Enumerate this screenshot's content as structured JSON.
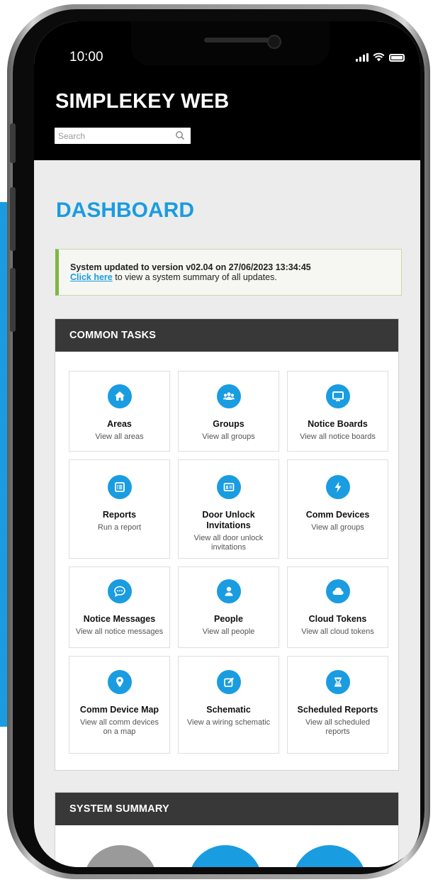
{
  "status": {
    "time": "10:00"
  },
  "header": {
    "app_title": "SIMPLEKEY WEB",
    "search_placeholder": "Search"
  },
  "page": {
    "title": "DASHBOARD"
  },
  "notice": {
    "message": "System updated to version v02.04 on 27/06/2023 13:34:45",
    "link_text": "Click here",
    "link_suffix": " to view a system summary of all updates."
  },
  "common_tasks": {
    "heading": "COMMON TASKS",
    "tiles": [
      {
        "title": "Areas",
        "desc": "View all areas",
        "icon": "home-icon"
      },
      {
        "title": "Groups",
        "desc": "View all groups",
        "icon": "users-icon"
      },
      {
        "title": "Notice Boards",
        "desc": "View all notice boards",
        "icon": "monitor-icon"
      },
      {
        "title": "Reports",
        "desc": "Run a report",
        "icon": "list-icon"
      },
      {
        "title": "Door Unlock Invitations",
        "desc": "View all door unlock invitations",
        "icon": "id-card-icon"
      },
      {
        "title": "Comm Devices",
        "desc": "View all groups",
        "icon": "bolt-icon"
      },
      {
        "title": "Notice Messages",
        "desc": "View all notice messages",
        "icon": "chat-icon"
      },
      {
        "title": "People",
        "desc": "View all people",
        "icon": "person-icon"
      },
      {
        "title": "Cloud Tokens",
        "desc": "View all cloud tokens",
        "icon": "cloud-icon"
      },
      {
        "title": "Comm Device Map",
        "desc": "View all comm devices on a map",
        "icon": "map-pin-icon"
      },
      {
        "title": "Schematic",
        "desc": "View a wiring schematic",
        "icon": "edit-icon"
      },
      {
        "title": "Scheduled Reports",
        "desc": "View all scheduled reports",
        "icon": "hourglass-icon"
      }
    ]
  },
  "system_summary": {
    "heading": "SYSTEM SUMMARY"
  },
  "colors": {
    "accent": "#1a9ce0",
    "header_bg": "#000000",
    "card_head": "#383838",
    "notice_border": "#7cb844"
  }
}
